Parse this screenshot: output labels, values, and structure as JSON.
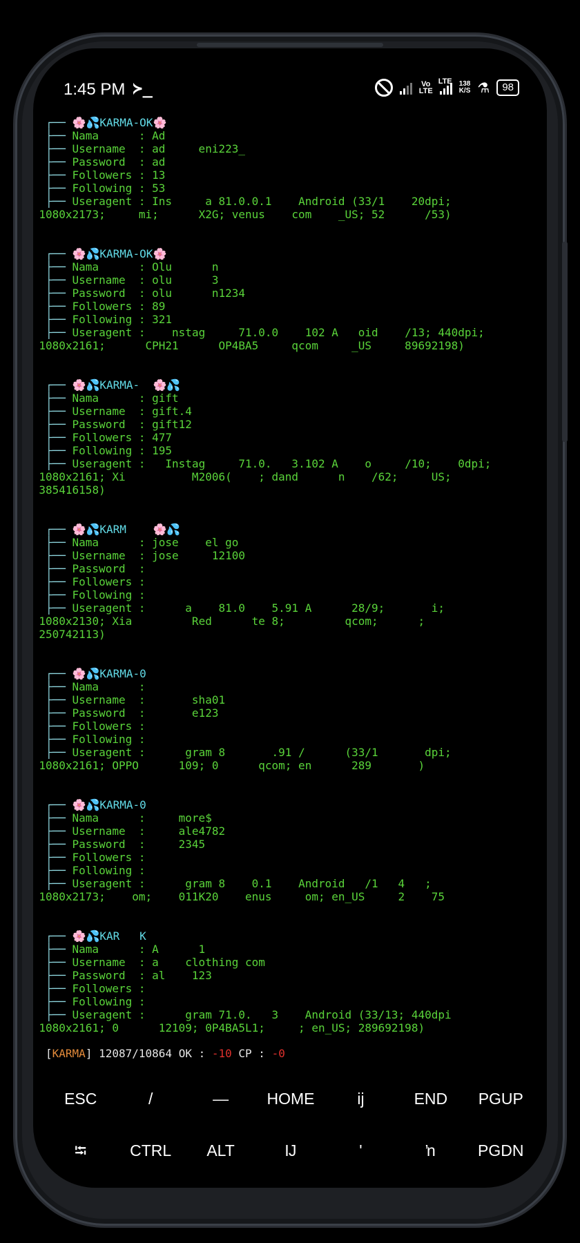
{
  "status_bar": {
    "time": "1:45 PM",
    "prompt_glyph": "≻_",
    "volte": "Vo\nLTE",
    "lte": "LTE",
    "speed_value": "138",
    "speed_unit": "K/S",
    "battery": "98",
    "icons": [
      "do-not-disturb-icon",
      "signal-icon",
      "flask-icon",
      "battery-icon"
    ]
  },
  "entries": [
    {
      "header": "🌸💦KARMA-OK🌸",
      "nama": "Ad",
      "username": "ad     eni223_",
      "password": "ad",
      "followers": "13",
      "following": "53",
      "useragent": "Ins     a 81.0.0.1    Android (33/1    20dpi;",
      "useragent_cont": "1080x2173;     mi;      X2G; venus    com    _US; 52      /53)"
    },
    {
      "header": "🌸💦KARMA-OK🌸",
      "nama": "Olu      n",
      "username": "olu      3",
      "password": "olu      n1234",
      "followers": "89",
      "following": "321",
      "useragent": "   nstag     71.0.0    102 A   oid    /13; 440dpi;",
      "useragent_cont": "1080x2161;      CPH21      OP4BA5     qcom     _US     89692198)"
    },
    {
      "header": "🌸💦KARMA-  🌸💦",
      "nama": "gift",
      "username": "gift.4",
      "password": "gift12",
      "followers": "477",
      "following": "195",
      "useragent": "  Instag     71.0.   3.102 A    o     /10;    0dpi;",
      "useragent_cont": "1080x2161; Xi          M2006(    ; dand      n    /62;     US;",
      "useragent_cont2": "385416158)"
    },
    {
      "header": "🌸💦KARM    🌸💦",
      "nama": "jose    el go",
      "username": "jose     12100",
      "password": "",
      "followers": "",
      "following": "",
      "useragent": "     a    81.0    5.91 A      28/9;       i;",
      "useragent_cont": "1080x2130; Xia         Red      te 8;         qcom;      ;",
      "useragent_cont2": "250742113)"
    },
    {
      "header": "🌸💦KARMA-0",
      "nama": "",
      "username": "      sha01",
      "password": "      e123",
      "followers": "",
      "following": "",
      "useragent": "     gram 8       .91 /      (33/1       dpi;",
      "useragent_cont": "1080x2161; OPPO      109; 0      qcom; en      289       )"
    },
    {
      "header": "🌸💦KARMA-0",
      "nama": "    more$",
      "username": "    ale4782",
      "password": "    2345",
      "followers": "",
      "following": "",
      "useragent": "     gram 8    0.1    Android   /1   4   ;",
      "useragent_cont": "1080x2173;    om;    011K20    enus     om; en_US     2    75"
    },
    {
      "header": "🌸💦KAR   K",
      "nama": "A      1",
      "username": "a    clothing com",
      "password": "al    123",
      "followers": "",
      "following": "",
      "useragent": "     gram 71.0.   3    Android (33/13; 440dpi",
      "useragent_cont": "1080x2161; 0      12109; 0P4BA5L1;     ; en_US; 289692198)"
    }
  ],
  "labels": {
    "nama": "Nama",
    "username": "Username",
    "password": "Password",
    "followers": "Followers",
    "following": "Following",
    "useragent": "Useragent"
  },
  "summary": {
    "tag": "KARMA",
    "progress": "12087/10864",
    "ok_label": "OK",
    "ok_value": "-10",
    "cp_label": "CP",
    "cp_value": "-0"
  },
  "extra_keys": {
    "row1": [
      "ESC",
      "/",
      "—",
      "HOME",
      "ĳ",
      "END",
      "PGUP"
    ],
    "row2": [
      "⭾",
      "CTRL",
      "ALT",
      "Ĳ",
      "ʹ",
      "ŉ",
      "PGDN"
    ]
  },
  "colors": {
    "terminal_text": "#5ad43a",
    "header_text": "#62dae6",
    "karma_tag": "#e28a3a",
    "negative": "#e0312d"
  }
}
